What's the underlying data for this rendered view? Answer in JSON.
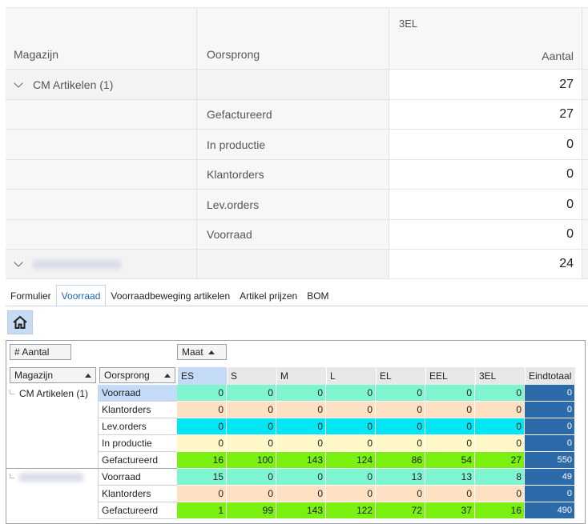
{
  "colors": {
    "voorraad": "#7ff5cf",
    "klantorders": "#fde1c2",
    "levorders": "#00e6f3",
    "inproductie": "#fff7c7",
    "gefactureerd": "#79f00f",
    "total": "#2d6aaa",
    "selected_header": "#c3dbf6"
  },
  "top_grid": {
    "header": {
      "col1": "Magazijn",
      "col2": "Oorsprong",
      "col3_group": "3EL",
      "col3": "Aantal"
    },
    "groups": [
      {
        "label": "CM Artikelen (1)",
        "total": "27",
        "expanded": true,
        "rows": [
          {
            "origin": "Gefactureerd",
            "value": "27"
          },
          {
            "origin": "In productie",
            "value": "0"
          },
          {
            "origin": "Klantorders",
            "value": "0"
          },
          {
            "origin": "Lev.orders",
            "value": "0"
          },
          {
            "origin": "Voorraad",
            "value": "0"
          }
        ]
      },
      {
        "label": "",
        "total": "24",
        "expanded": true,
        "rows": []
      }
    ],
    "icons": {
      "expand": "chevron-down-icon"
    }
  },
  "tabs": [
    {
      "label": "Formulier",
      "active": false
    },
    {
      "label": "Voorraad",
      "active": true
    },
    {
      "label": "Voorraadbeweging artikelen",
      "active": false
    },
    {
      "label": "Artikel prijzen",
      "active": false
    },
    {
      "label": "BOM",
      "active": false
    }
  ],
  "home_button": {
    "icon": "home-icon"
  },
  "pivot": {
    "data_field": "# Aantal",
    "column_field": "Maat",
    "row_fields": [
      "Magazijn",
      "Oorsprong"
    ],
    "columns": [
      "ES",
      "S",
      "M",
      "L",
      "EL",
      "EEL",
      "3EL",
      "Eindtotaal"
    ],
    "groups": [
      {
        "magazijn": "CM Artikelen (1)",
        "rows": [
          {
            "origin": "Voorraad",
            "kind": "voorraad",
            "values": [
              "0",
              "0",
              "0",
              "0",
              "0",
              "0",
              "0",
              "0"
            ]
          },
          {
            "origin": "Klantorders",
            "kind": "klantorders",
            "values": [
              "0",
              "0",
              "0",
              "0",
              "0",
              "0",
              "0",
              "0"
            ]
          },
          {
            "origin": "Lev.orders",
            "kind": "levorders",
            "values": [
              "0",
              "0",
              "0",
              "0",
              "0",
              "0",
              "0",
              "0"
            ]
          },
          {
            "origin": "In productie",
            "kind": "inproductie",
            "values": [
              "0",
              "0",
              "0",
              "0",
              "0",
              "0",
              "0",
              "0"
            ]
          },
          {
            "origin": "Gefactureerd",
            "kind": "gefactureerd",
            "values": [
              "16",
              "100",
              "143",
              "124",
              "86",
              "54",
              "27",
              "550"
            ]
          }
        ]
      },
      {
        "magazijn": "",
        "rows": [
          {
            "origin": "Voorraad",
            "kind": "voorraad",
            "values": [
              "15",
              "0",
              "0",
              "0",
              "13",
              "13",
              "8",
              "49"
            ]
          },
          {
            "origin": "Klantorders",
            "kind": "klantorders",
            "values": [
              "0",
              "0",
              "0",
              "0",
              "0",
              "0",
              "0",
              "0"
            ]
          },
          {
            "origin": "Gefactureerd",
            "kind": "gefactureerd",
            "values": [
              "1",
              "99",
              "143",
              "122",
              "72",
              "37",
              "16",
              "490"
            ]
          }
        ]
      }
    ]
  }
}
